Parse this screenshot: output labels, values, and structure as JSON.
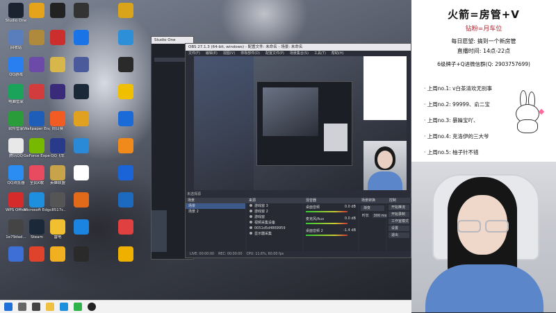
{
  "desktop_icons": [
    {
      "label": "Studio One",
      "color": "#1c2330"
    },
    {
      "label": "回收站",
      "color": "#5a7dbb"
    },
    {
      "label": "QQ游戏",
      "color": "#2a7ff0"
    },
    {
      "label": "电脑管家",
      "color": "#1aa35a"
    },
    {
      "label": "软件管家",
      "color": "#2a9d3a"
    },
    {
      "label": "腾讯QQ",
      "color": "#e8e8e8"
    },
    {
      "label": "QQ浏览器",
      "color": "#2b8cf2"
    },
    {
      "label": "WPS Office",
      "color": "#d52b2b"
    },
    {
      "label": "1e79dad...",
      "color": "#444"
    },
    {
      "label": "",
      "color": "#3d6fd6"
    },
    {
      "label": "",
      "color": "#e5a21b"
    },
    {
      "label": "",
      "color": "#b08a3c"
    },
    {
      "label": "",
      "color": "#6b4aa8"
    },
    {
      "label": "",
      "color": "#d23c3c"
    },
    {
      "label": "Wallpaper Engine",
      "color": "#1f5eb8"
    },
    {
      "label": "GeForce Experience",
      "color": "#76b900"
    },
    {
      "label": "全民K歌",
      "color": "#e84a5f"
    },
    {
      "label": "Microsoft Edge",
      "color": "#1d8fdc"
    },
    {
      "label": "Steam",
      "color": "#1b2838"
    },
    {
      "label": "",
      "color": "#e0432b"
    },
    {
      "label": "",
      "color": "#222"
    },
    {
      "label": "",
      "color": "#cc2d2d"
    },
    {
      "label": "",
      "color": "#d7b64b"
    },
    {
      "label": "",
      "color": "#3a2a7a"
    },
    {
      "label": "向日葵",
      "color": "#f25c22"
    },
    {
      "label": "QQ飞车",
      "color": "#2a3a8a"
    },
    {
      "label": "英雄联盟",
      "color": "#c7a34a"
    },
    {
      "label": "c8517c..",
      "color": "#555"
    },
    {
      "label": "雷电",
      "color": "#f0c030"
    },
    {
      "label": "",
      "color": "#f0b020"
    },
    {
      "label": "",
      "color": "#333"
    },
    {
      "label": "",
      "color": "#1a74e8"
    },
    {
      "label": "",
      "color": "#4a5a9a"
    },
    {
      "label": "",
      "color": "#1b2838"
    },
    {
      "label": "",
      "color": "#e0a020"
    },
    {
      "label": "",
      "color": "#2a8ad8"
    },
    {
      "label": "",
      "color": "#ffffff"
    },
    {
      "label": "",
      "color": "#e06a1a"
    },
    {
      "label": "",
      "color": "#1a84e0"
    },
    {
      "label": "",
      "color": "#2a2a2a"
    },
    {
      "label": "",
      "color": "#d9a31a"
    },
    {
      "label": "",
      "color": "#2c8fd8"
    },
    {
      "label": "",
      "color": "#2a2a2a"
    },
    {
      "label": "",
      "color": "#f0c000"
    },
    {
      "label": "",
      "color": "#1a6ad8"
    },
    {
      "label": "",
      "color": "#f08a1a"
    },
    {
      "label": "",
      "color": "#1a64d8"
    },
    {
      "label": "",
      "color": "#1b6ac0"
    },
    {
      "label": "",
      "color": "#e04040"
    },
    {
      "label": "",
      "color": "#f0b000"
    }
  ],
  "studio_one": {
    "title": "Studio One"
  },
  "obs": {
    "title": "OBS 27.1.3 (64-bit, windows) - 配置文件: 未命名 - 场景: 未命名",
    "menu": [
      "文件(F)",
      "编辑(E)",
      "视图(V)",
      "停靠部件(D)",
      "配置文件(P)",
      "场景集合(S)",
      "工具(T)",
      "帮助(H)"
    ],
    "source_hint": "未选择源",
    "dock_scenes": "场景",
    "dock_sources": "来源",
    "dock_mixer": "混音器",
    "dock_transitions": "场景转换",
    "dock_controls": "控制",
    "scenes": [
      "场景",
      "场景 2"
    ],
    "sources": [
      "游戏窗 3",
      "游戏窗 2",
      "游戏窗",
      "视频采集设备",
      "0051d5d4869959",
      "显示器采集"
    ],
    "mixer": [
      {
        "name": "桌面音频",
        "value": "0.0 dB"
      },
      {
        "name": "麦克风/Aux",
        "value": "0.0 dB"
      },
      {
        "name": "桌面音频 2",
        "value": "-1.4 dB"
      }
    ],
    "transition": "渐变",
    "duration": "300 ms",
    "duration_label": "时长",
    "controls": [
      "开始推流",
      "开始录制",
      "工作室模式",
      "设置",
      "退出"
    ],
    "status": [
      "LIVE: 00:00:00",
      "REC: 00:00:00",
      "CPU: 11.6%, 60.00 fps"
    ]
  },
  "sidepanel": {
    "title": "火箭=房管+V",
    "subtitle": "钻粉=月车位",
    "line1": "每日愿望: 搞到一个新房管",
    "line2": "直播时间: 14点-22点",
    "line3": "6级牌子+Q进微信群(Q: 2903757699)",
    "ranks": [
      "上周no.1: v白茶清欢无别事",
      "上周no.2: 99999、俞二宝",
      "上周no.3: 暴躁宝吖、",
      "上周no.4: 克洛伊的三大爷",
      "上周no.5: 柚子针不错"
    ]
  },
  "taskbar": {
    "icons": [
      "start-icon",
      "search-icon",
      "taskview-icon",
      "explorer-icon",
      "edge-icon",
      "wechat-icon",
      "obs-icon",
      "studio-icon"
    ]
  }
}
